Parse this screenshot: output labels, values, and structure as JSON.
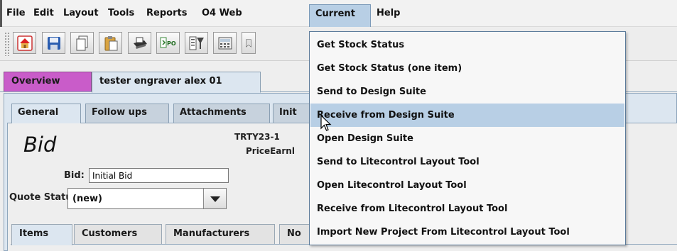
{
  "menubar": {
    "items": [
      "File",
      "Edit",
      "Layout",
      "Tools",
      "Reports",
      "O4 Web",
      "Current",
      "Help"
    ]
  },
  "toolbar": {
    "buttons": [
      "home-icon",
      "save-icon",
      "copy-icon",
      "paste-icon",
      "print-icon",
      "po-icon",
      "filter-icon",
      "calculator-icon",
      "bookmark-icon"
    ],
    "po_label": "PO"
  },
  "doc_tabs": [
    "Overview",
    "tester engraver alex 01"
  ],
  "sub_tabs": [
    "General",
    "Follow ups",
    "Attachments",
    "Init"
  ],
  "form": {
    "title": "Bid",
    "ref_number": "TRTY23-1",
    "price_label": "PriceEarnl",
    "bid_label": "Bid:",
    "bid_value": "Initial Bid",
    "quote_status_label": "Quote Status:",
    "quote_status_value": "(new)"
  },
  "bottom_tabs": [
    "Items",
    "Customers",
    "Manufacturers",
    "No"
  ],
  "current_menu": {
    "items": [
      "Get Stock Status",
      "Get Stock Status (one item)",
      "Send to Design Suite",
      "Receive from Design Suite",
      "Open Design Suite",
      "Send to Litecontrol Layout Tool",
      "Open Litecontrol Layout Tool",
      "Receive from Litecontrol Layout Tool",
      "Import New Project From Litecontrol Layout Tool"
    ],
    "highlighted_index": 3
  },
  "colors": {
    "overview_tab": "#c95cc9",
    "menu_highlight": "#b8cfe5",
    "pane_background": "#dce6f0"
  }
}
